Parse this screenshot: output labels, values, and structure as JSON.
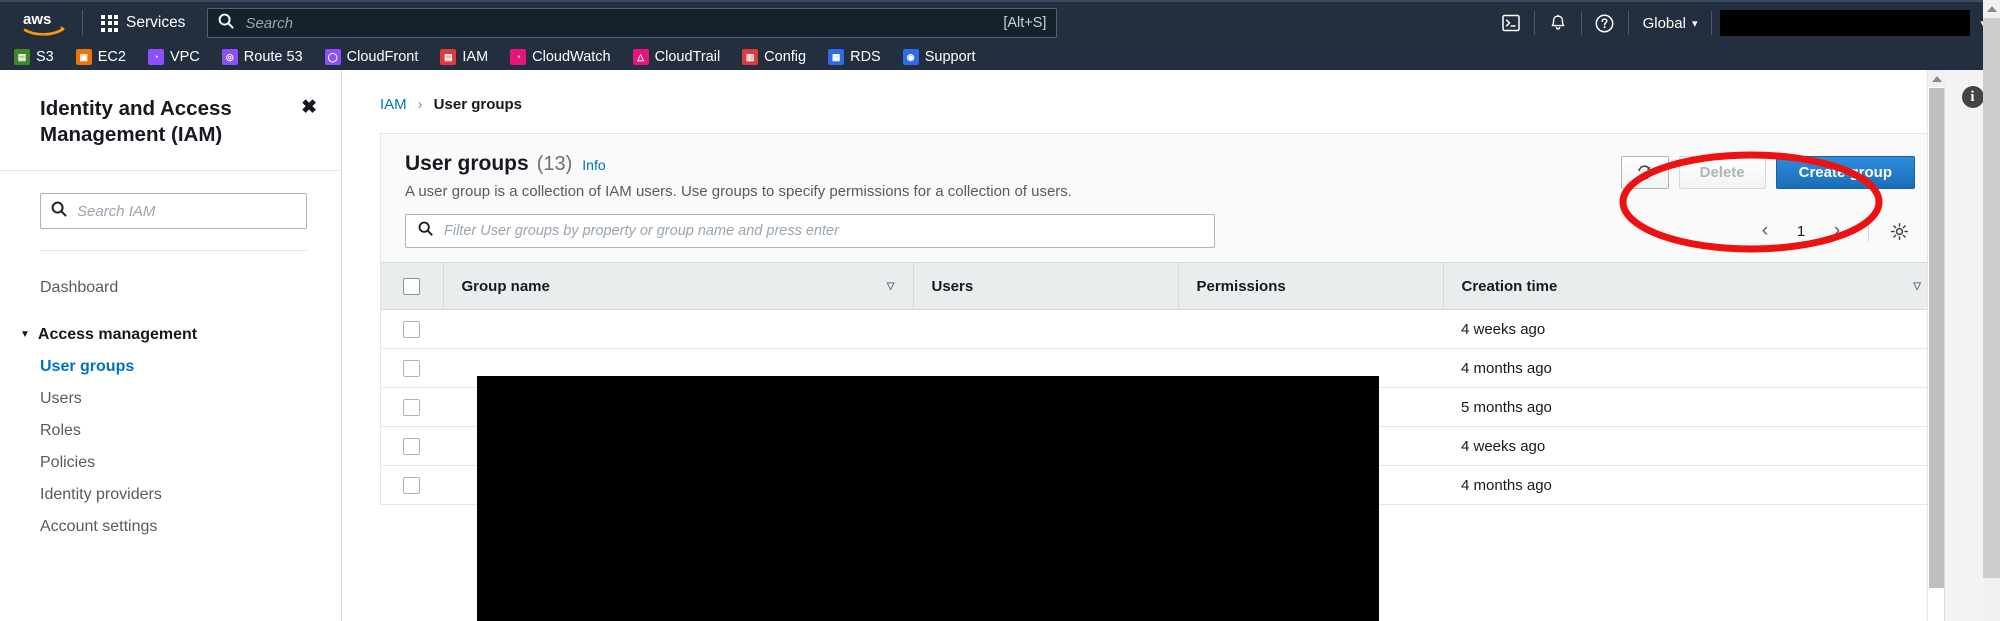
{
  "topnav": {
    "logo_alt": "aws",
    "services_label": "Services",
    "search_placeholder": "Search",
    "search_value": "",
    "search_shortcut": "[Alt+S]",
    "cloudshell_icon": "cloudshell-icon",
    "notifications_icon": "bell-icon",
    "help_icon": "help-icon",
    "region_label": "Global",
    "region_caret": "▾",
    "account_label": "",
    "account_caret": "▾"
  },
  "shortcuts": [
    {
      "label": "S3",
      "color": "#3f8624",
      "glyph": "▤"
    },
    {
      "label": "EC2",
      "color": "#e8740c",
      "glyph": "▣"
    },
    {
      "label": "VPC",
      "color": "#8c4fff",
      "glyph": "◔"
    },
    {
      "label": "Route 53",
      "color": "#8c4fff",
      "glyph": "◎"
    },
    {
      "label": "CloudFront",
      "color": "#8c4fff",
      "glyph": "◯"
    },
    {
      "label": "IAM",
      "color": "#dd3c3c",
      "glyph": "▤"
    },
    {
      "label": "CloudWatch",
      "color": "#e7157b",
      "glyph": "◔"
    },
    {
      "label": "CloudTrail",
      "color": "#e7157b",
      "glyph": "△"
    },
    {
      "label": "Config",
      "color": "#dd3c3c",
      "glyph": "▥"
    },
    {
      "label": "RDS",
      "color": "#2e6be6",
      "glyph": "▦"
    },
    {
      "label": "Support",
      "color": "#2e6be6",
      "glyph": "◉"
    }
  ],
  "sidebar": {
    "title": "Identity and Access Management (IAM)",
    "close_icon": "✖",
    "search_placeholder": "Search IAM",
    "search_value": "",
    "dashboard_label": "Dashboard",
    "group_label": "Access management",
    "group_caret": "▼",
    "items": [
      {
        "label": "User groups",
        "active": true
      },
      {
        "label": "Users",
        "active": false
      },
      {
        "label": "Roles",
        "active": false
      },
      {
        "label": "Policies",
        "active": false
      },
      {
        "label": "Identity providers",
        "active": false
      },
      {
        "label": "Account settings",
        "active": false
      }
    ]
  },
  "breadcrumb": {
    "root": "IAM",
    "separator": "›",
    "current": "User groups"
  },
  "panel": {
    "title": "User groups",
    "count": "(13)",
    "info_label": "Info",
    "description": "A user group is a collection of IAM users. Use groups to specify permissions for a collection of users.",
    "refresh_icon": "↻",
    "delete_label": "Delete",
    "create_label": "Create group",
    "filter_placeholder": "Filter User groups by property or group name and press enter",
    "filter_value": "",
    "page_prev": "‹",
    "page_number": "1",
    "page_next": "›",
    "settings_icon": "gear-icon"
  },
  "table": {
    "columns": [
      {
        "label": "Group name",
        "sortable": true
      },
      {
        "label": "Users",
        "sortable": false
      },
      {
        "label": "Permissions",
        "sortable": false
      },
      {
        "label": "Creation time",
        "sortable": true
      }
    ],
    "sort_icon": "▽",
    "rows": [
      {
        "group_name": "",
        "users": "",
        "permissions": "",
        "creation_time": "4 weeks ago"
      },
      {
        "group_name": "",
        "users": "",
        "permissions": "",
        "creation_time": "4 months ago"
      },
      {
        "group_name": "",
        "users": "",
        "permissions": "",
        "creation_time": "5 months ago"
      },
      {
        "group_name": "",
        "users": "",
        "permissions": "",
        "creation_time": "4 weeks ago"
      },
      {
        "group_name": "",
        "users": "",
        "permissions": "",
        "creation_time": "4 months ago"
      }
    ]
  },
  "annotation": {
    "shape": "ellipse",
    "color": "#ee1111",
    "stroke_width": 7,
    "target": "create-group-button"
  },
  "right_rail": {
    "info_icon": "i"
  },
  "colors": {
    "navy": "#232f3e",
    "link_blue": "#0073bb",
    "primary_button": "#1b6eb8",
    "annotation_red": "#ee1111"
  }
}
